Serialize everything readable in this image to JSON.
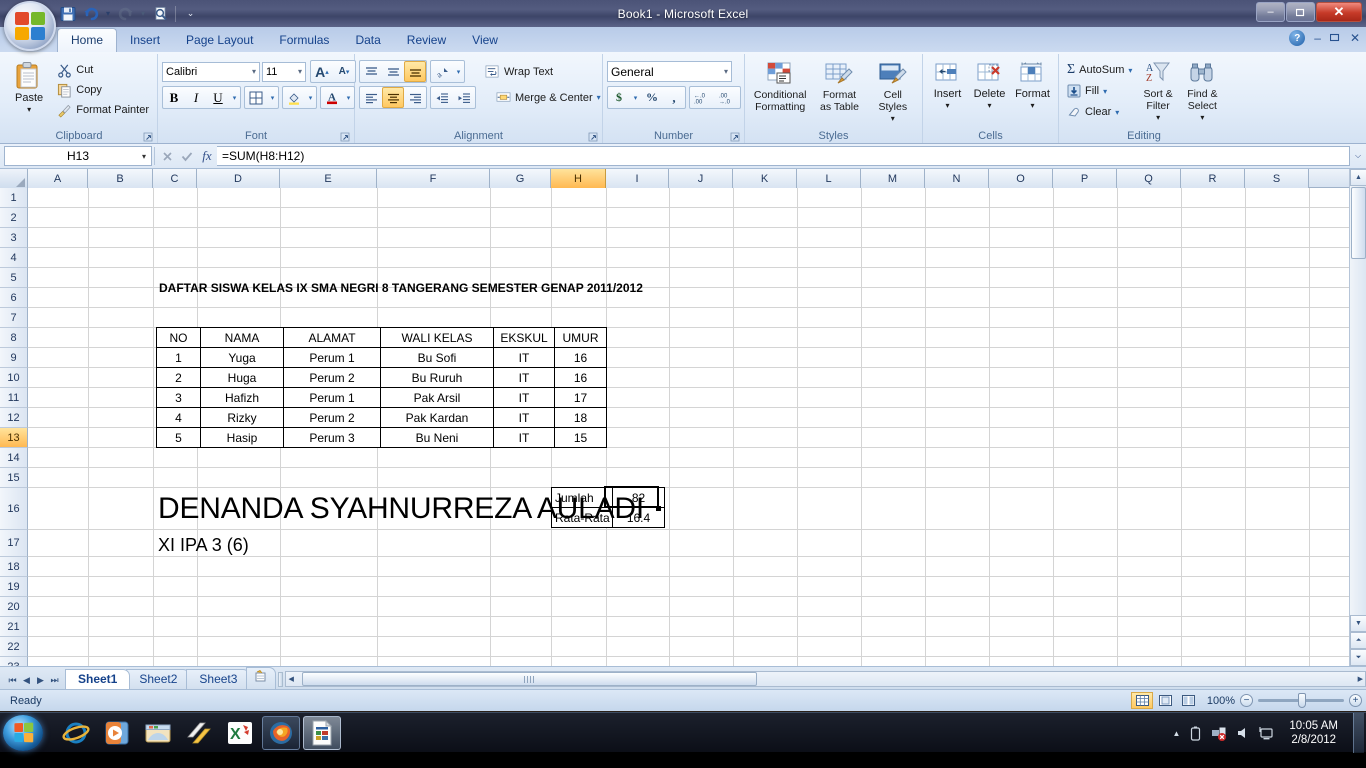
{
  "window": {
    "title": "Book1 - Microsoft Excel",
    "minimize": "–",
    "maximize": "❐",
    "close": "✕"
  },
  "quick_access": {
    "save": "save-icon",
    "undo": "undo-icon",
    "redo": "redo-icon",
    "print_preview": "print-preview-icon",
    "customize": "customize-qat-icon"
  },
  "ribbon": {
    "tabs": [
      {
        "label": "Home",
        "active": true
      },
      {
        "label": "Insert",
        "active": false
      },
      {
        "label": "Page Layout",
        "active": false
      },
      {
        "label": "Formulas",
        "active": false
      },
      {
        "label": "Data",
        "active": false
      },
      {
        "label": "Review",
        "active": false
      },
      {
        "label": "View",
        "active": false
      }
    ],
    "help": "?",
    "win_min": "–",
    "win_restore": "❐",
    "win_close": "✕",
    "groups": {
      "clipboard": {
        "label": "Clipboard",
        "paste": "Paste",
        "cut": "Cut",
        "copy": "Copy",
        "format_painter": "Format Painter"
      },
      "font": {
        "label": "Font",
        "font_name": "Calibri",
        "font_size": "11",
        "grow_font": "A",
        "shrink_font": "A",
        "bold": "B",
        "italic": "I",
        "underline": "U",
        "borders": "borders-icon",
        "fill_color": "fill-color-icon",
        "font_color": "A"
      },
      "alignment": {
        "label": "Alignment",
        "wrap_text": "Wrap Text",
        "merge_center": "Merge & Center",
        "align_top": "align-top-icon",
        "align_middle": "align-middle-icon",
        "align_bottom": "align-bottom-icon",
        "orientation": "orientation-icon",
        "align_left": "align-left-icon",
        "align_center": "align-center-icon",
        "align_right": "align-right-icon",
        "decrease_indent": "decrease-indent-icon",
        "increase_indent": "increase-indent-icon"
      },
      "number": {
        "label": "Number",
        "format": "General",
        "currency": "$",
        "percent": "%",
        "comma": ",",
        "increase_decimal": "⁺.0",
        "decrease_decimal": ".00"
      },
      "styles": {
        "label": "Styles",
        "conditional_formatting": "Conditional\nFormatting",
        "conditional_formatting_l1": "Conditional",
        "conditional_formatting_l2": "Formatting",
        "format_as_table_l1": "Format",
        "format_as_table_l2": "as Table",
        "cell_styles_l1": "Cell",
        "cell_styles_l2": "Styles"
      },
      "cells": {
        "label": "Cells",
        "insert": "Insert",
        "delete": "Delete",
        "format": "Format"
      },
      "editing": {
        "label": "Editing",
        "autosum": "AutoSum",
        "fill": "Fill",
        "clear": "Clear",
        "sort_filter_l1": "Sort &",
        "sort_filter_l2": "Filter",
        "find_select_l1": "Find &",
        "find_select_l2": "Select"
      }
    }
  },
  "formula_bar": {
    "name_box": "H13",
    "formula": "=SUM(H8:H12)",
    "fx": "fx",
    "cancel": "✕",
    "enter": "✓",
    "expand": "⌵"
  },
  "grid": {
    "columns": [
      "A",
      "B",
      "C",
      "D",
      "E",
      "F",
      "G",
      "H",
      "I",
      "J",
      "K",
      "L",
      "M",
      "N",
      "O",
      "P",
      "Q",
      "R",
      "S"
    ],
    "selected_column": "H",
    "rows": [
      "1",
      "2",
      "3",
      "4",
      "5",
      "6",
      "7",
      "8",
      "9",
      "10",
      "11",
      "12",
      "13",
      "14",
      "15",
      "16",
      "17",
      "18",
      "19",
      "20",
      "21",
      "22",
      "23"
    ],
    "selected_row": "13",
    "active_cell": "H13"
  },
  "sheet_content": {
    "title": "DAFTAR SISWA KELAS IX SMA NEGRI 8 TANGERANG SEMESTER GENAP 2011/2012",
    "table_headers": [
      "NO",
      "NAMA",
      "ALAMAT",
      "WALI KELAS",
      "EKSKUL",
      "UMUR"
    ],
    "table_rows": [
      [
        "1",
        "Yuga",
        "Perum 1",
        "Bu Sofi",
        "IT",
        "16"
      ],
      [
        "2",
        "Huga",
        "Perum 2",
        "Bu Ruruh",
        "IT",
        "16"
      ],
      [
        "3",
        "Hafizh",
        "Perum 1",
        "Pak Arsil",
        "IT",
        "17"
      ],
      [
        "4",
        "Rizky",
        "Perum 2",
        "Pak Kardan",
        "IT",
        "18"
      ],
      [
        "5",
        "Hasip",
        "Perum 3",
        "Bu Neni",
        "IT",
        "15"
      ]
    ],
    "summary": [
      {
        "label": "Jumlah",
        "value": "82"
      },
      {
        "label": "Rata-Rata",
        "value": "16.4"
      }
    ],
    "big_name": "DENANDA SYAHNURREZA AULADI",
    "class_label": "XI IPA 3 (6)"
  },
  "sheet_tabs": {
    "first": "⏮",
    "prev": "◀",
    "next": "▶",
    "last": "⏭",
    "tabs": [
      {
        "label": "Sheet1",
        "active": true
      },
      {
        "label": "Sheet2",
        "active": false
      },
      {
        "label": "Sheet3",
        "active": false
      }
    ],
    "insert_sheet": "insert-worksheet-icon"
  },
  "status_bar": {
    "status": "Ready",
    "view_normal": "normal-view-icon",
    "view_page_layout": "page-layout-view-icon",
    "view_page_break": "page-break-view-icon",
    "zoom": "100%",
    "zoom_out": "−",
    "zoom_in": "+"
  },
  "taskbar": {
    "start": "start-button",
    "items": [
      {
        "name": "internet-explorer-icon"
      },
      {
        "name": "media-player-icon"
      },
      {
        "name": "file-explorer-icon"
      },
      {
        "name": "winamp-icon"
      },
      {
        "name": "excel-icon"
      },
      {
        "name": "firefox-icon",
        "state": "running"
      },
      {
        "name": "excel-document-icon",
        "state": "active"
      }
    ],
    "tray": {
      "show_hidden": "▲",
      "battery": "battery-icon",
      "network": "network-icon",
      "volume": "volume-icon",
      "action_center": "action-center-icon"
    },
    "time": "10:05 AM",
    "date": "2/8/2012"
  }
}
